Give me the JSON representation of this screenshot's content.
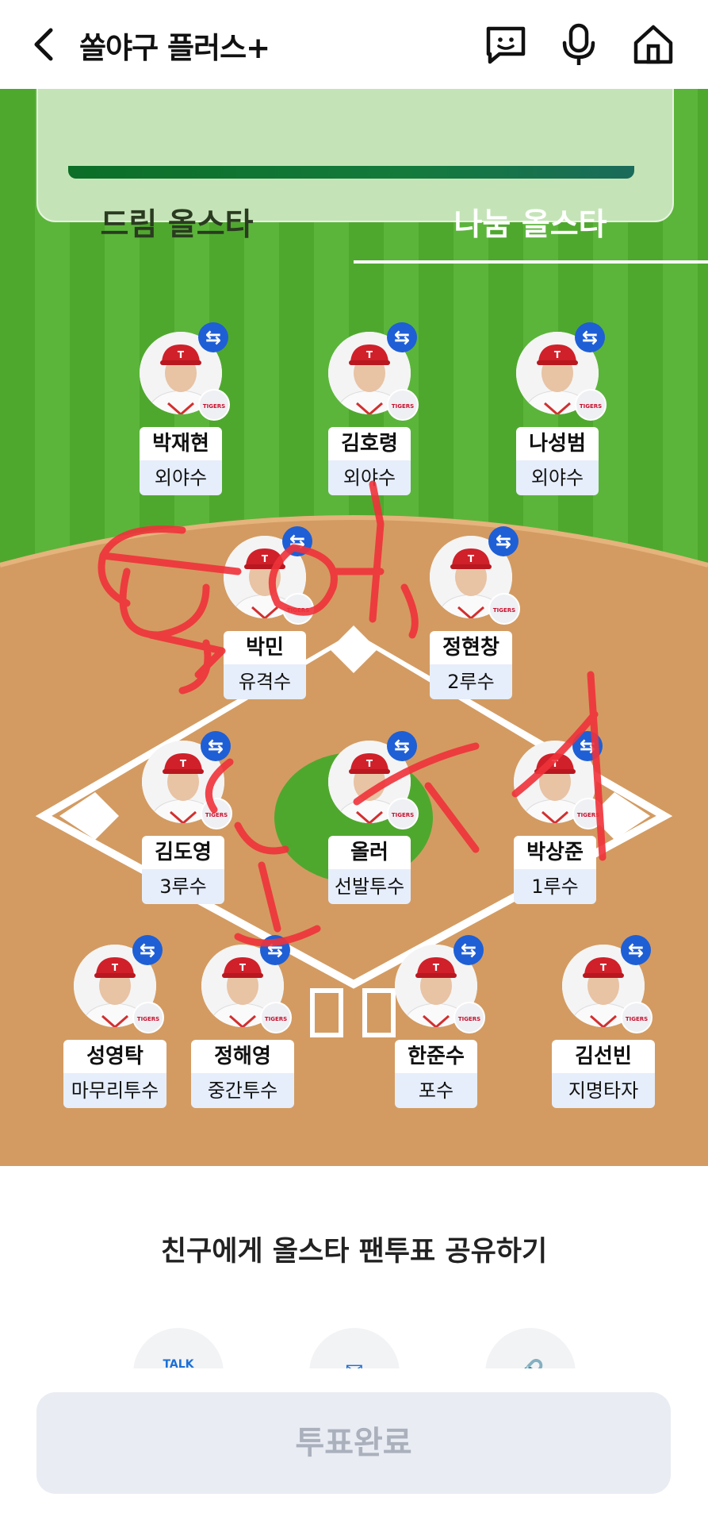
{
  "header": {
    "back_icon": "chevron-left-icon",
    "title": "쏠야구 플러스+",
    "icons": [
      "chat-face-icon",
      "microphone-icon",
      "home-icon"
    ]
  },
  "tabs": [
    {
      "label": "드림 올스타",
      "active": false
    },
    {
      "label": "나눔 올스타",
      "active": true
    }
  ],
  "players": [
    {
      "name": "박재현",
      "position": "외야수"
    },
    {
      "name": "김호령",
      "position": "외야수"
    },
    {
      "name": "나성범",
      "position": "외야수"
    },
    {
      "name": "박민",
      "position": "유격수"
    },
    {
      "name": "정현창",
      "position": "2루수"
    },
    {
      "name": "김도영",
      "position": "3루수"
    },
    {
      "name": "올러",
      "position": "선발투수"
    },
    {
      "name": "박상준",
      "position": "1루수"
    },
    {
      "name": "성영탁",
      "position": "마무리투수"
    },
    {
      "name": "정해영",
      "position": "중간투수"
    },
    {
      "name": "한준수",
      "position": "포수"
    },
    {
      "name": "김선빈",
      "position": "지명타자"
    }
  ],
  "team_logo_text": "TIGERS",
  "swap_icon_glyph": "⇆",
  "share": {
    "title": "친구에게 올스타 팬투표 공유하기",
    "buttons": [
      {
        "icon": "kakaotalk-icon",
        "glyph": "TALK"
      },
      {
        "icon": "mail-icon",
        "glyph": "✉"
      },
      {
        "icon": "link-icon",
        "glyph": "🔗"
      }
    ]
  },
  "vote_button": "투표완료",
  "colors": {
    "grass": "#4fa82e",
    "infield_dirt": "#d39b62",
    "swap_badge": "#1e5fd6",
    "handwriting": "#f0323a",
    "disabled_button": "#e9ecf3"
  }
}
